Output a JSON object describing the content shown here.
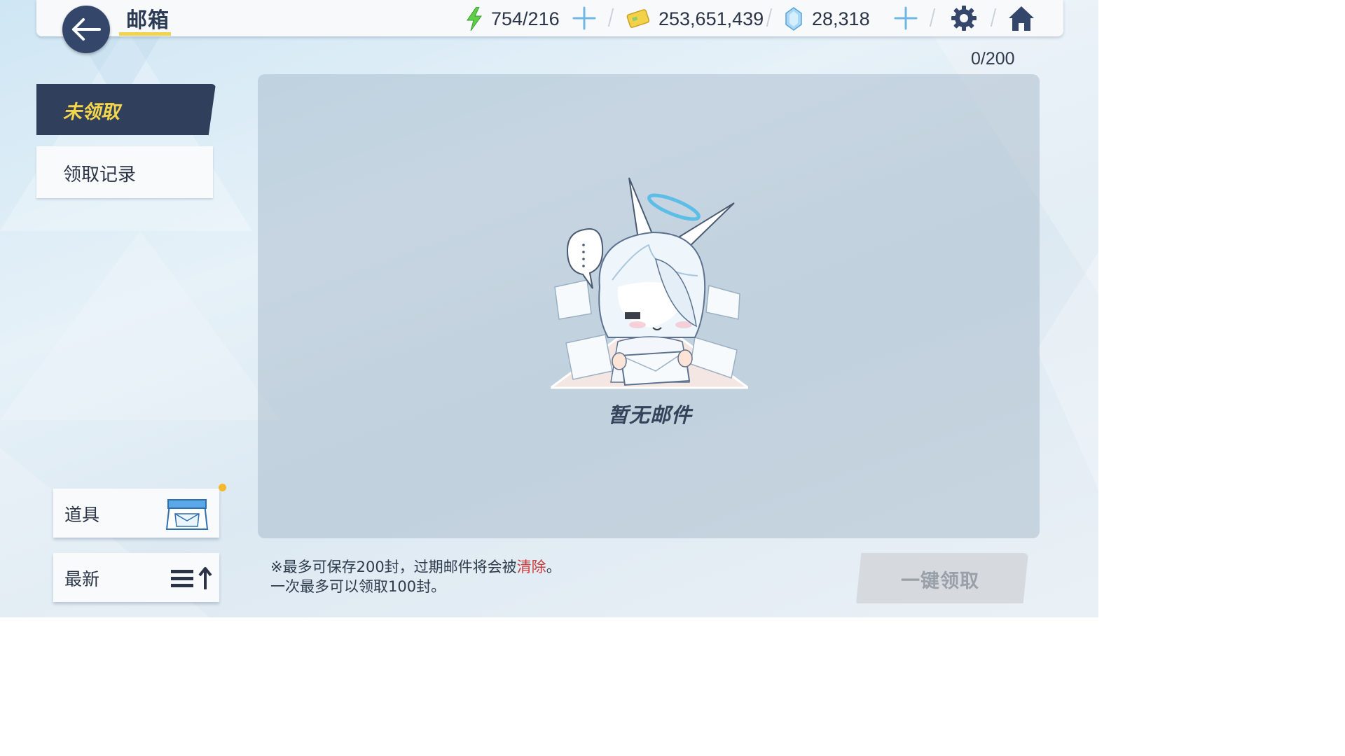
{
  "header": {
    "title": "邮箱",
    "stamina": "754/216",
    "credits": "253,651,439",
    "gems": "28,318"
  },
  "tabs": {
    "unclaimed": "未领取",
    "history": "领取记录"
  },
  "mail_count": "0/200",
  "empty_message": "暂无邮件",
  "filter": {
    "label": "道具"
  },
  "sort": {
    "label": "最新"
  },
  "notice": {
    "line1_before": "※最多可保存200封，过期邮件将会被",
    "line1_warn": "清除",
    "line1_after": "。",
    "line2": "一次最多可以领取100封。"
  },
  "claim_all_label": "一键领取",
  "colors": {
    "accent_yellow": "#f5d54a",
    "navy": "#2f3f5c",
    "warning_red": "#c83a3a",
    "notification_dot": "#f5b82a"
  },
  "icons": {
    "back": "arrow-left-icon",
    "stamina": "lightning-icon",
    "credits": "credit-card-icon",
    "gems": "crystal-icon",
    "settings": "gear-icon",
    "home": "home-icon",
    "filter": "mail-box-icon",
    "sort": "sort-ascending-icon"
  }
}
